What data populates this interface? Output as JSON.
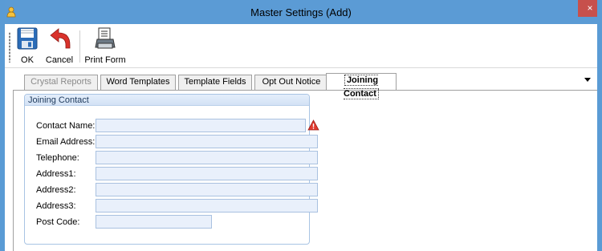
{
  "window": {
    "title": "Master Settings (Add)",
    "close_glyph": "×",
    "app_icon": "person-icon",
    "colors": {
      "titlebar": "#5b9bd5",
      "close": "#c7504c",
      "field_bg": "#e9f0fb"
    }
  },
  "toolbar": {
    "ok_label": "OK",
    "cancel_label": "Cancel",
    "print_label": "Print Form",
    "icons": [
      "floppy-disk-icon",
      "undo-arrow-icon",
      "print-form-icon"
    ]
  },
  "tabs": [
    {
      "label": "Crystal Reports",
      "state": "disabled"
    },
    {
      "label": "Word Templates",
      "state": "normal"
    },
    {
      "label": "Template Fields",
      "state": "normal"
    },
    {
      "label": "Opt Out Notice",
      "state": "normal"
    },
    {
      "label": "Joining Contact",
      "state": "active"
    }
  ],
  "group": {
    "title": "Joining Contact",
    "fields": [
      {
        "label": "Contact Name:",
        "value": "",
        "required": true
      },
      {
        "label": "Email Address:",
        "value": ""
      },
      {
        "label": "Telephone:",
        "value": ""
      },
      {
        "label": "Address1:",
        "value": ""
      },
      {
        "label": "Address2:",
        "value": ""
      },
      {
        "label": "Address3:",
        "value": ""
      },
      {
        "label": "Post Code:",
        "value": ""
      }
    ]
  }
}
